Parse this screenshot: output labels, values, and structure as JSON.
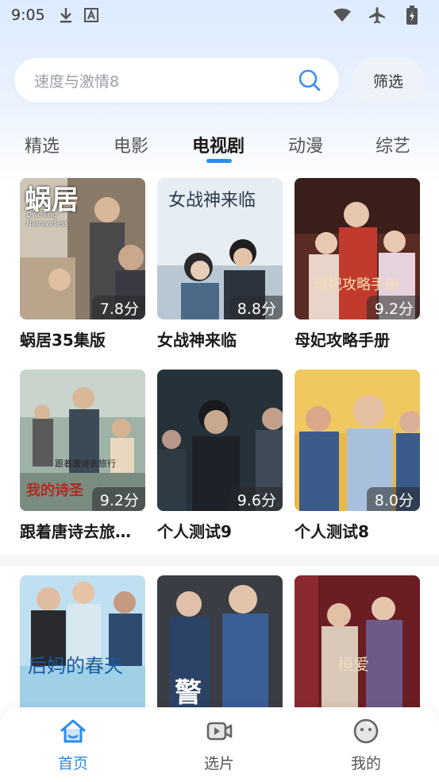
{
  "status_bar": {
    "time": "9:05",
    "icons_left": [
      "download-icon",
      "a-letter-icon"
    ],
    "icons_right": [
      "wifi-icon",
      "airplane-icon",
      "battery-icon"
    ]
  },
  "search": {
    "placeholder": "速度与激情8",
    "filter_label": "筛选"
  },
  "tabs": [
    {
      "label": "精选",
      "active": false
    },
    {
      "label": "电影",
      "active": false
    },
    {
      "label": "电视剧",
      "active": true
    },
    {
      "label": "动漫",
      "active": false
    },
    {
      "label": "综艺",
      "active": false
    }
  ],
  "cards": [
    {
      "title": "蜗居35集版",
      "rating": "7.8分",
      "poster_text": "蜗居",
      "poster_sub": "Dwelling Narrowness"
    },
    {
      "title": "女战神来临",
      "rating": "8.8分",
      "poster_text": "女战神来临"
    },
    {
      "title": "母妃攻略手册",
      "rating": "9.2分",
      "poster_text": "母妃攻略手册"
    },
    {
      "title": "跟着唐诗去旅…",
      "rating": "9.2分",
      "poster_text": "跟着唐诗去旅行",
      "poster_sub": "我的诗圣"
    },
    {
      "title": "个人测试9",
      "rating": "9.6分"
    },
    {
      "title": "个人测试8",
      "rating": "8.0分"
    },
    {
      "title": "",
      "rating": "",
      "poster_text": "后妈的春天"
    },
    {
      "title": "",
      "rating": "",
      "poster_text": "警"
    },
    {
      "title": "",
      "rating": "",
      "poster_text": "桓爱"
    }
  ],
  "bottom_nav": [
    {
      "label": "首页",
      "icon": "home-icon",
      "active": true
    },
    {
      "label": "选片",
      "icon": "video-icon",
      "active": false
    },
    {
      "label": "我的",
      "icon": "profile-face-icon",
      "active": false
    }
  ],
  "colors": {
    "accent": "#2a8cf0",
    "header_gradient_top": "#dcebff"
  }
}
